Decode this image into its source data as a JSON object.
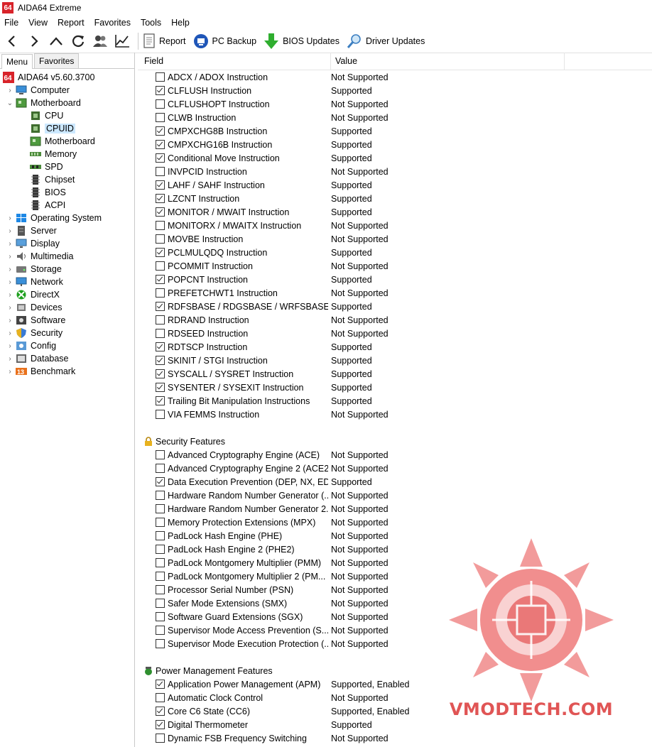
{
  "app": {
    "title": "AIDA64 Extreme",
    "icon_text": "64"
  },
  "menubar": {
    "items": [
      "File",
      "View",
      "Report",
      "Favorites",
      "Tools",
      "Help"
    ]
  },
  "toolbar": {
    "nav_icons": [
      "back-icon",
      "forward-icon",
      "up-icon",
      "refresh-icon",
      "user-icon",
      "chart-icon"
    ],
    "report": "Report",
    "pc_backup": "PC Backup",
    "bios_updates": "BIOS Updates",
    "driver_updates": "Driver Updates"
  },
  "left": {
    "tabs": [
      "Menu",
      "Favorites"
    ],
    "tree": [
      {
        "label": "AIDA64 v5.60.3700",
        "level": 0,
        "icon": "aida64-icon",
        "chevron": ""
      },
      {
        "label": "Computer",
        "level": 1,
        "icon": "computer-icon",
        "chevron": "›"
      },
      {
        "label": "Motherboard",
        "level": 1,
        "icon": "motherboard-icon",
        "chevron": "⌄"
      },
      {
        "label": "CPU",
        "level": 2,
        "icon": "cpu-icon",
        "chevron": ""
      },
      {
        "label": "CPUID",
        "level": 2,
        "icon": "cpuid-icon",
        "chevron": "",
        "selected": true
      },
      {
        "label": "Motherboard",
        "level": 2,
        "icon": "motherboard-icon",
        "chevron": ""
      },
      {
        "label": "Memory",
        "level": 2,
        "icon": "memory-icon",
        "chevron": ""
      },
      {
        "label": "SPD",
        "level": 2,
        "icon": "spd-icon",
        "chevron": ""
      },
      {
        "label": "Chipset",
        "level": 2,
        "icon": "chipset-icon",
        "chevron": ""
      },
      {
        "label": "BIOS",
        "level": 2,
        "icon": "bios-icon",
        "chevron": ""
      },
      {
        "label": "ACPI",
        "level": 2,
        "icon": "acpi-icon",
        "chevron": ""
      },
      {
        "label": "Operating System",
        "level": 1,
        "icon": "windows-icon",
        "chevron": "›"
      },
      {
        "label": "Server",
        "level": 1,
        "icon": "server-icon",
        "chevron": "›"
      },
      {
        "label": "Display",
        "level": 1,
        "icon": "display-icon",
        "chevron": "›"
      },
      {
        "label": "Multimedia",
        "level": 1,
        "icon": "multimedia-icon",
        "chevron": "›"
      },
      {
        "label": "Storage",
        "level": 1,
        "icon": "storage-icon",
        "chevron": "›"
      },
      {
        "label": "Network",
        "level": 1,
        "icon": "network-icon",
        "chevron": "›"
      },
      {
        "label": "DirectX",
        "level": 1,
        "icon": "directx-icon",
        "chevron": "›"
      },
      {
        "label": "Devices",
        "level": 1,
        "icon": "devices-icon",
        "chevron": "›"
      },
      {
        "label": "Software",
        "level": 1,
        "icon": "software-icon",
        "chevron": "›"
      },
      {
        "label": "Security",
        "level": 1,
        "icon": "security-icon",
        "chevron": "›"
      },
      {
        "label": "Config",
        "level": 1,
        "icon": "config-icon",
        "chevron": "›"
      },
      {
        "label": "Database",
        "level": 1,
        "icon": "database-icon",
        "chevron": "›"
      },
      {
        "label": "Benchmark",
        "level": 1,
        "icon": "benchmark-icon",
        "chevron": "›"
      }
    ]
  },
  "table": {
    "columns": [
      "Field",
      "Value"
    ],
    "groups": [
      {
        "section": null,
        "rows": [
          {
            "field": "ADCX / ADOX Instruction",
            "value": "Not Supported",
            "checked": false
          },
          {
            "field": "CLFLUSH Instruction",
            "value": "Supported",
            "checked": true
          },
          {
            "field": "CLFLUSHOPT Instruction",
            "value": "Not Supported",
            "checked": false
          },
          {
            "field": "CLWB Instruction",
            "value": "Not Supported",
            "checked": false
          },
          {
            "field": "CMPXCHG8B Instruction",
            "value": "Supported",
            "checked": true
          },
          {
            "field": "CMPXCHG16B Instruction",
            "value": "Supported",
            "checked": true
          },
          {
            "field": "Conditional Move Instruction",
            "value": "Supported",
            "checked": true
          },
          {
            "field": "INVPCID Instruction",
            "value": "Not Supported",
            "checked": false
          },
          {
            "field": "LAHF / SAHF Instruction",
            "value": "Supported",
            "checked": true
          },
          {
            "field": "LZCNT Instruction",
            "value": "Supported",
            "checked": true
          },
          {
            "field": "MONITOR / MWAIT Instruction",
            "value": "Supported",
            "checked": true
          },
          {
            "field": "MONITORX / MWAITX Instruction",
            "value": "Not Supported",
            "checked": false
          },
          {
            "field": "MOVBE Instruction",
            "value": "Not Supported",
            "checked": false
          },
          {
            "field": "PCLMULQDQ Instruction",
            "value": "Supported",
            "checked": true
          },
          {
            "field": "PCOMMIT Instruction",
            "value": "Not Supported",
            "checked": false
          },
          {
            "field": "POPCNT Instruction",
            "value": "Supported",
            "checked": true
          },
          {
            "field": "PREFETCHWT1 Instruction",
            "value": "Not Supported",
            "checked": false
          },
          {
            "field": "RDFSBASE / RDGSBASE / WRFSBASE / W...",
            "value": "Supported",
            "checked": true
          },
          {
            "field": "RDRAND Instruction",
            "value": "Not Supported",
            "checked": false
          },
          {
            "field": "RDSEED Instruction",
            "value": "Not Supported",
            "checked": false
          },
          {
            "field": "RDTSCP Instruction",
            "value": "Supported",
            "checked": true
          },
          {
            "field": "SKINIT / STGI Instruction",
            "value": "Supported",
            "checked": true
          },
          {
            "field": "SYSCALL / SYSRET Instruction",
            "value": "Supported",
            "checked": true
          },
          {
            "field": "SYSENTER / SYSEXIT Instruction",
            "value": "Supported",
            "checked": true
          },
          {
            "field": "Trailing Bit Manipulation Instructions",
            "value": "Supported",
            "checked": true
          },
          {
            "field": "VIA FEMMS Instruction",
            "value": "Not Supported",
            "checked": false
          }
        ]
      },
      {
        "section": "Security Features",
        "section_icon": "lock-icon",
        "rows": [
          {
            "field": "Advanced Cryptography Engine (ACE)",
            "value": "Not Supported",
            "checked": false
          },
          {
            "field": "Advanced Cryptography Engine 2 (ACE2)",
            "value": "Not Supported",
            "checked": false
          },
          {
            "field": "Data Execution Prevention (DEP, NX, EDB)",
            "value": "Supported",
            "checked": true
          },
          {
            "field": "Hardware Random Number Generator (...",
            "value": "Not Supported",
            "checked": false
          },
          {
            "field": "Hardware Random Number Generator 2...",
            "value": "Not Supported",
            "checked": false
          },
          {
            "field": "Memory Protection Extensions (MPX)",
            "value": "Not Supported",
            "checked": false
          },
          {
            "field": "PadLock Hash Engine (PHE)",
            "value": "Not Supported",
            "checked": false
          },
          {
            "field": "PadLock Hash Engine 2 (PHE2)",
            "value": "Not Supported",
            "checked": false
          },
          {
            "field": "PadLock Montgomery Multiplier (PMM)",
            "value": "Not Supported",
            "checked": false
          },
          {
            "field": "PadLock Montgomery Multiplier 2 (PM...",
            "value": "Not Supported",
            "checked": false
          },
          {
            "field": "Processor Serial Number (PSN)",
            "value": "Not Supported",
            "checked": false
          },
          {
            "field": "Safer Mode Extensions (SMX)",
            "value": "Not Supported",
            "checked": false
          },
          {
            "field": "Software Guard Extensions (SGX)",
            "value": "Not Supported",
            "checked": false
          },
          {
            "field": "Supervisor Mode Access Prevention (S...",
            "value": "Not Supported",
            "checked": false
          },
          {
            "field": "Supervisor Mode Execution Protection (...",
            "value": "Not Supported",
            "checked": false
          }
        ]
      },
      {
        "section": "Power Management Features",
        "section_icon": "power-management-icon",
        "rows": [
          {
            "field": "Application Power Management (APM)",
            "value": "Supported, Enabled",
            "checked": true
          },
          {
            "field": "Automatic Clock Control",
            "value": "Not Supported",
            "checked": false
          },
          {
            "field": "Core C6 State (CC6)",
            "value": "Supported, Enabled",
            "checked": true
          },
          {
            "field": "Digital Thermometer",
            "value": "Supported",
            "checked": true
          },
          {
            "field": "Dynamic FSB Frequency Switching",
            "value": "Not Supported",
            "checked": false
          }
        ]
      }
    ]
  },
  "watermark": {
    "text": "VMODTECH.COM"
  },
  "colors": {
    "selected": "#cce8ff",
    "brand_red": "#d8232a",
    "watermark": "#e05555"
  }
}
